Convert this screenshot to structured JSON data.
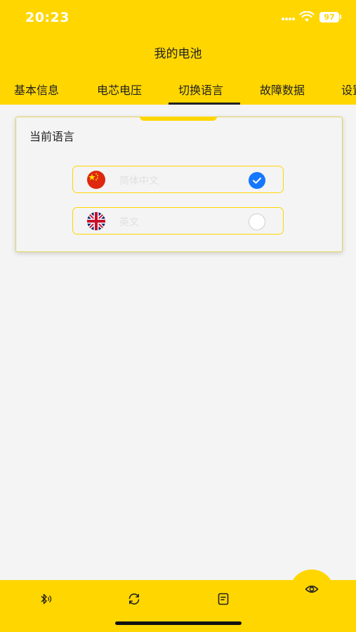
{
  "status_bar": {
    "time": "20:23",
    "battery": "97"
  },
  "page": {
    "title": "我的电池"
  },
  "tabs": [
    {
      "label": "基本信息"
    },
    {
      "label": "电芯电压"
    },
    {
      "label": "切换语言",
      "active": true
    },
    {
      "label": "故障数据"
    },
    {
      "label": "设置"
    }
  ],
  "language_card": {
    "title": "当前语言",
    "options": [
      {
        "label": "简体中文",
        "flag": "china-flag-icon",
        "selected": true
      },
      {
        "label": "英文",
        "flag": "uk-flag-icon",
        "selected": false
      }
    ]
  },
  "bottom_nav": [
    {
      "icon": "bluetooth-icon"
    },
    {
      "icon": "refresh-icon"
    },
    {
      "icon": "document-icon"
    },
    {
      "icon": "eye-icon"
    }
  ],
  "colors": {
    "accent": "#ffd600",
    "selected": "#1677ff",
    "background": "#f4f4f4"
  }
}
